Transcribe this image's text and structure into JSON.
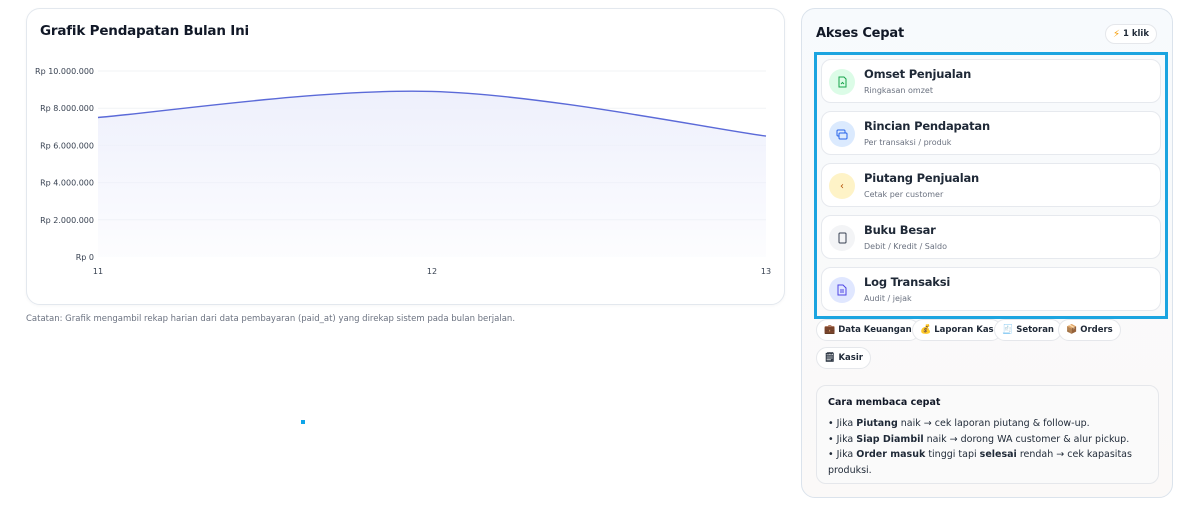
{
  "chart_card": {
    "title": "Grafik Pendapatan Bulan Ini",
    "note": "Catatan: Grafik mengambil rekap harian dari data pembayaran (paid_at) yang direkap sistem pada bulan berjalan."
  },
  "chart_data": {
    "type": "area",
    "title": "Grafik Pendapatan Bulan Ini",
    "x": [
      "11",
      "12",
      "13"
    ],
    "values": [
      7500000,
      8900000,
      6500000
    ],
    "ylim": [
      0,
      10000000
    ],
    "y_ticks": [
      0,
      2000000,
      4000000,
      6000000,
      8000000,
      10000000
    ],
    "y_tick_labels": [
      "Rp 0",
      "Rp 2.000.000",
      "Rp 4.000.000",
      "Rp 6.000.000",
      "Rp 8.000.000",
      "Rp 10.000.000"
    ],
    "line_color": "#5b6ad8",
    "fill_color": "#eef0fc",
    "grid": true,
    "legend": false
  },
  "panel": {
    "title": "Akses Cepat",
    "badge_label": "1 klik",
    "quick_links": [
      {
        "title": "Omset Penjualan",
        "subtitle": "Ringkasan omzet",
        "icon": "document-icon",
        "icon_bg": "#dcfce7",
        "icon_color": "#16a34a"
      },
      {
        "title": "Rincian Pendapatan",
        "subtitle": "Per transaksi / produk",
        "icon": "cards-icon",
        "icon_bg": "#dbeafe",
        "icon_color": "#2563eb"
      },
      {
        "title": "Piutang Penjualan",
        "subtitle": "Cetak per customer",
        "icon": "chevron-left-icon",
        "icon_bg": "#fef3c7",
        "icon_color": "#b45309"
      },
      {
        "title": "Buku Besar",
        "subtitle": "Debit / Kredit / Saldo",
        "icon": "book-icon",
        "icon_bg": "#f3f4f6",
        "icon_color": "#374151"
      },
      {
        "title": "Log Transaksi",
        "subtitle": "Audit / jejak",
        "icon": "file-icon",
        "icon_bg": "#e0e7ff",
        "icon_color": "#4f46e5"
      }
    ],
    "chips": [
      {
        "label": "Data Keuangan",
        "icon": "💼",
        "icon_name": "briefcase-icon"
      },
      {
        "label": "Laporan Kas",
        "icon": "💰",
        "icon_name": "money-bag-icon"
      },
      {
        "label": "Setoran",
        "icon": "🧾",
        "icon_name": "receipt-icon"
      },
      {
        "label": "Orders",
        "icon": "📦",
        "icon_name": "package-icon"
      },
      {
        "label": "Kasir",
        "icon": "🗒",
        "icon_name": "notepad-icon"
      }
    ],
    "howto": {
      "title": "Cara membaca cepat",
      "line1": {
        "prefix": "• Jika ",
        "bold1": "Piutang",
        "rest": " naik → cek laporan piutang & follow-up."
      },
      "line2": {
        "prefix": "• Jika ",
        "bold1": "Siap Diambil",
        "rest": " naik → dorong WA customer & alur pickup."
      },
      "line3": {
        "prefix": "• Jika ",
        "bold1": "Order masuk",
        "mid": " tinggi tapi ",
        "bold2": "selesai",
        "rest": " rendah → cek kapasitas produksi."
      }
    }
  }
}
